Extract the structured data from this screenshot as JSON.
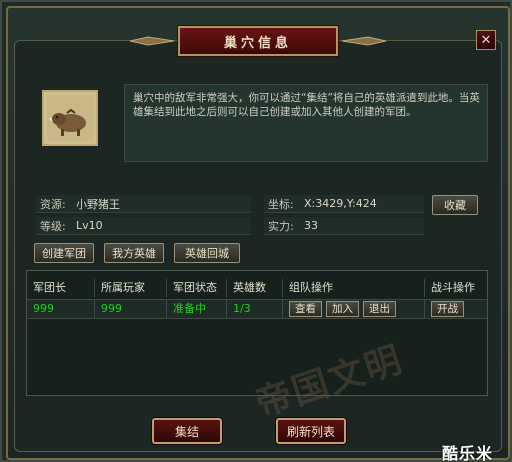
{
  "window": {
    "title": "巢穴信息",
    "close": "✕"
  },
  "description": "巢穴中的敌军非常强大，你可以通过“集结”将自己的英雄派遣到此地。当英雄集结到此地之后则可以自己创建或加入其他人创建的军团。",
  "info": {
    "source_label": "资源:",
    "source_value": "小野猪王",
    "level_label": "等级:",
    "level_value": "Lv10",
    "coord_label": "坐标:",
    "coord_value": "X:3429,Y:424",
    "power_label": "实力:",
    "power_value": "33",
    "favorite_button": "收藏"
  },
  "actions": {
    "create_legion": "创建军团",
    "my_heroes": "我方英雄",
    "hero_recall": "英雄回城"
  },
  "table": {
    "headers": [
      "军团长",
      "所属玩家",
      "军团状态",
      "英雄数",
      "组队操作",
      "战斗操作"
    ],
    "rows": [
      {
        "leader": "999",
        "player": "999",
        "status": "准备中",
        "heroes": "1/3",
        "view": "查看",
        "join": "加入",
        "quit": "退出",
        "fight": "开战"
      }
    ]
  },
  "watermark": "帝国文明",
  "bottom": {
    "gather": "集结",
    "refresh": "刷新列表"
  },
  "brand": "酷乐米",
  "colors": {
    "accent_red": "#5a1212",
    "gold_border": "#b8a070",
    "status_green": "#1fd01f"
  }
}
